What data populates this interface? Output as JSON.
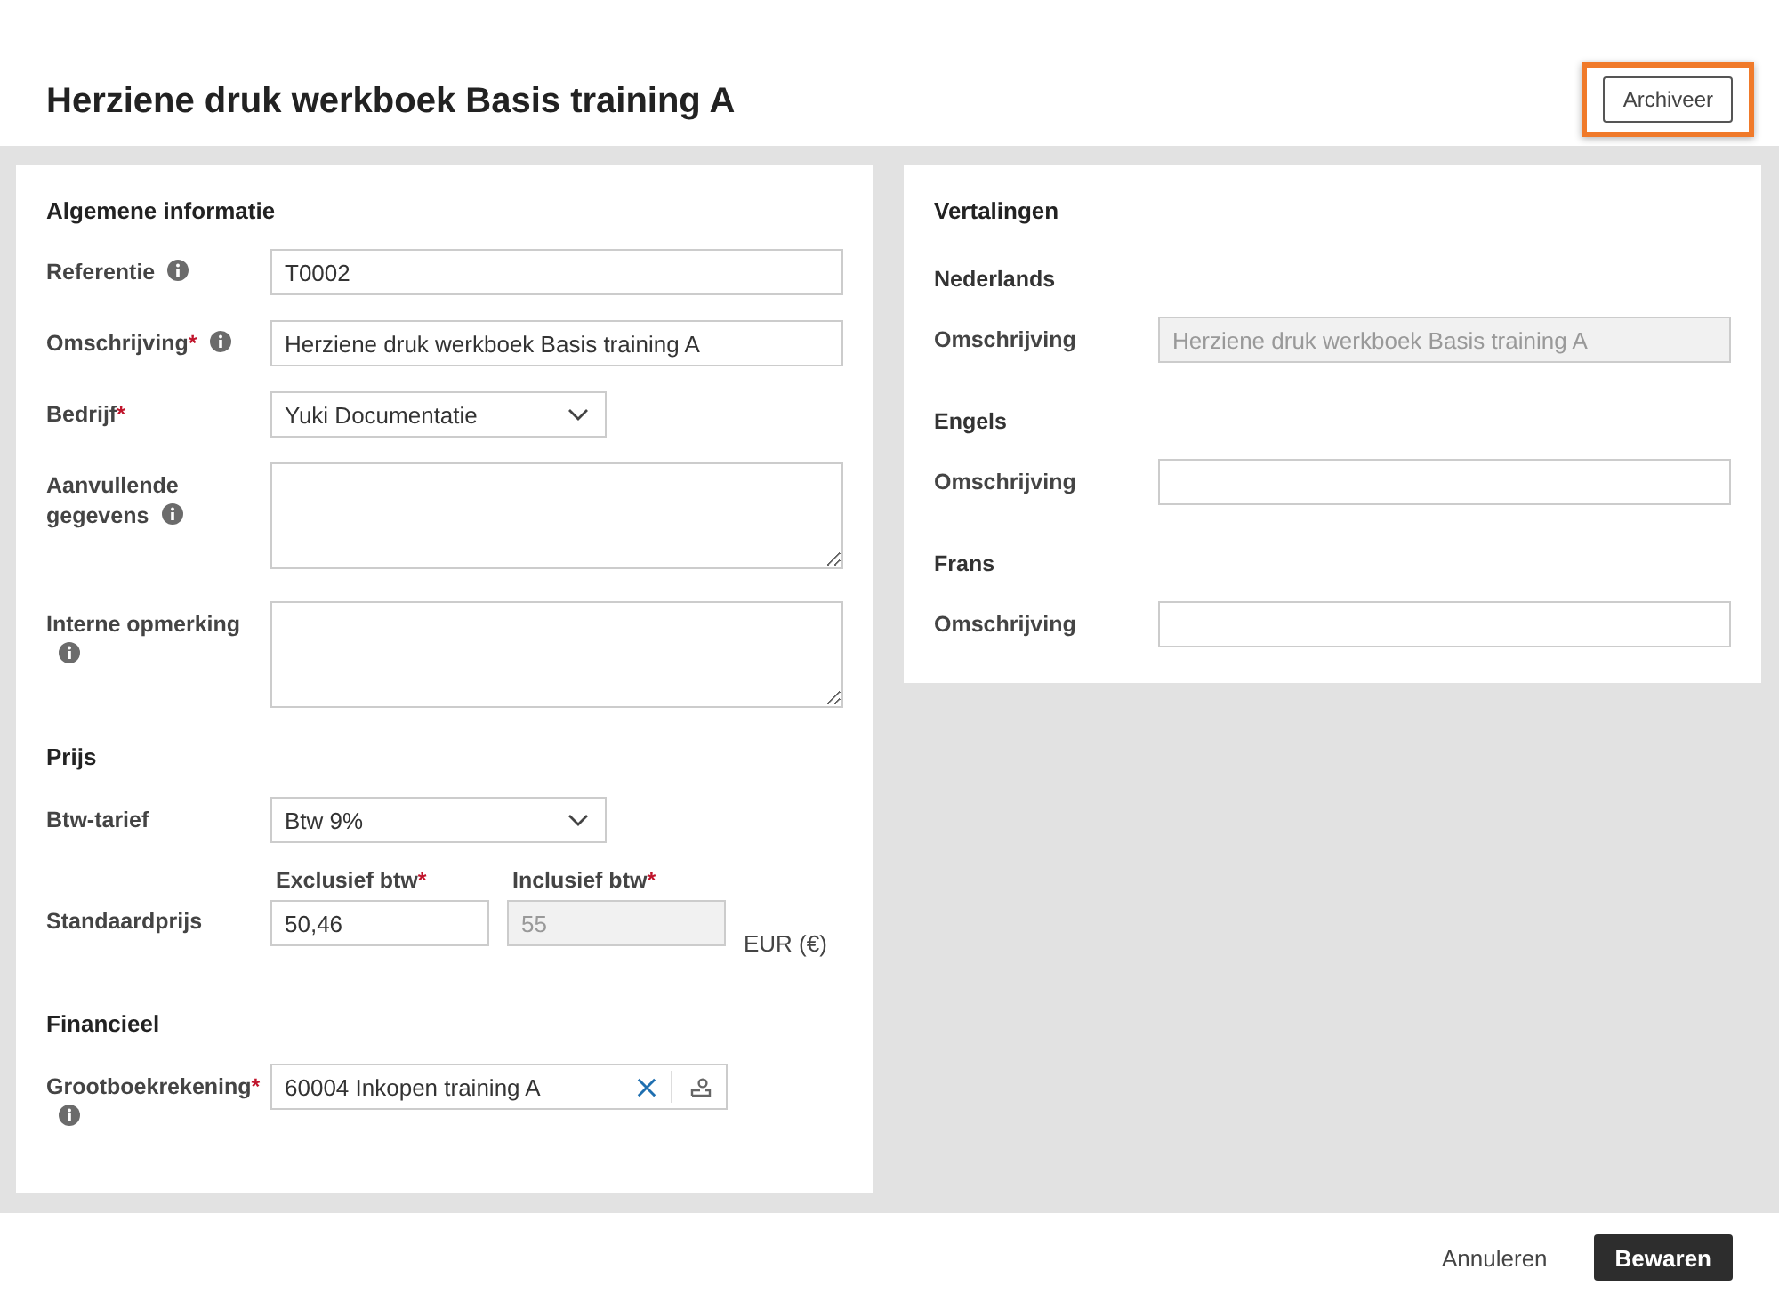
{
  "title": "Herziene druk werkboek Basis training A",
  "archive_button": {
    "label": "Archiveer",
    "highlighted": true
  },
  "general": {
    "heading": "Algemene informatie",
    "fields": [
      {
        "kind": "input",
        "label": "Referentie",
        "info": true,
        "value": "T0002"
      },
      {
        "kind": "input",
        "label": "Omschrijving",
        "required_mark": "*",
        "info": true,
        "value": "Herziene druk werkboek Basis training A"
      },
      {
        "kind": "select",
        "label": "Bedrijf",
        "required_mark": "*",
        "info": false,
        "value": "Yuki Documentatie"
      },
      {
        "kind": "textarea",
        "label": "Aanvullende gegevens",
        "info": true
      },
      {
        "kind": "textarea",
        "label": "Interne opmerking",
        "info": true
      }
    ]
  },
  "price": {
    "heading": "Prijs",
    "vat": {
      "label": "Btw-tarief",
      "value": "Btw 9%"
    },
    "standard": {
      "label": "Standaardprijs",
      "unit": "EUR (€)",
      "inputs": [
        {
          "label": "Exclusief btw",
          "required_mark": "*",
          "value": "50,46",
          "disabled": false
        },
        {
          "label": "Inclusief btw",
          "required_mark": "*",
          "value": "55",
          "disabled": true
        }
      ]
    }
  },
  "financial": {
    "heading": "Financieel",
    "account": {
      "label": "Grootboekrekening",
      "required_mark": "*",
      "info": true,
      "value": "60004 Inkopen training A"
    }
  },
  "translations": {
    "heading": "Vertalingen",
    "languages": [
      {
        "name": "Nederlands",
        "label": "Omschrijving",
        "value": "Herziene druk werkboek Basis training A",
        "disabled": true
      },
      {
        "name": "Engels",
        "label": "Omschrijving",
        "disabled": false
      },
      {
        "name": "Frans",
        "label": "Omschrijving",
        "disabled": false
      }
    ]
  },
  "footer": {
    "cancel": "Annuleren",
    "save": "Bewaren"
  }
}
